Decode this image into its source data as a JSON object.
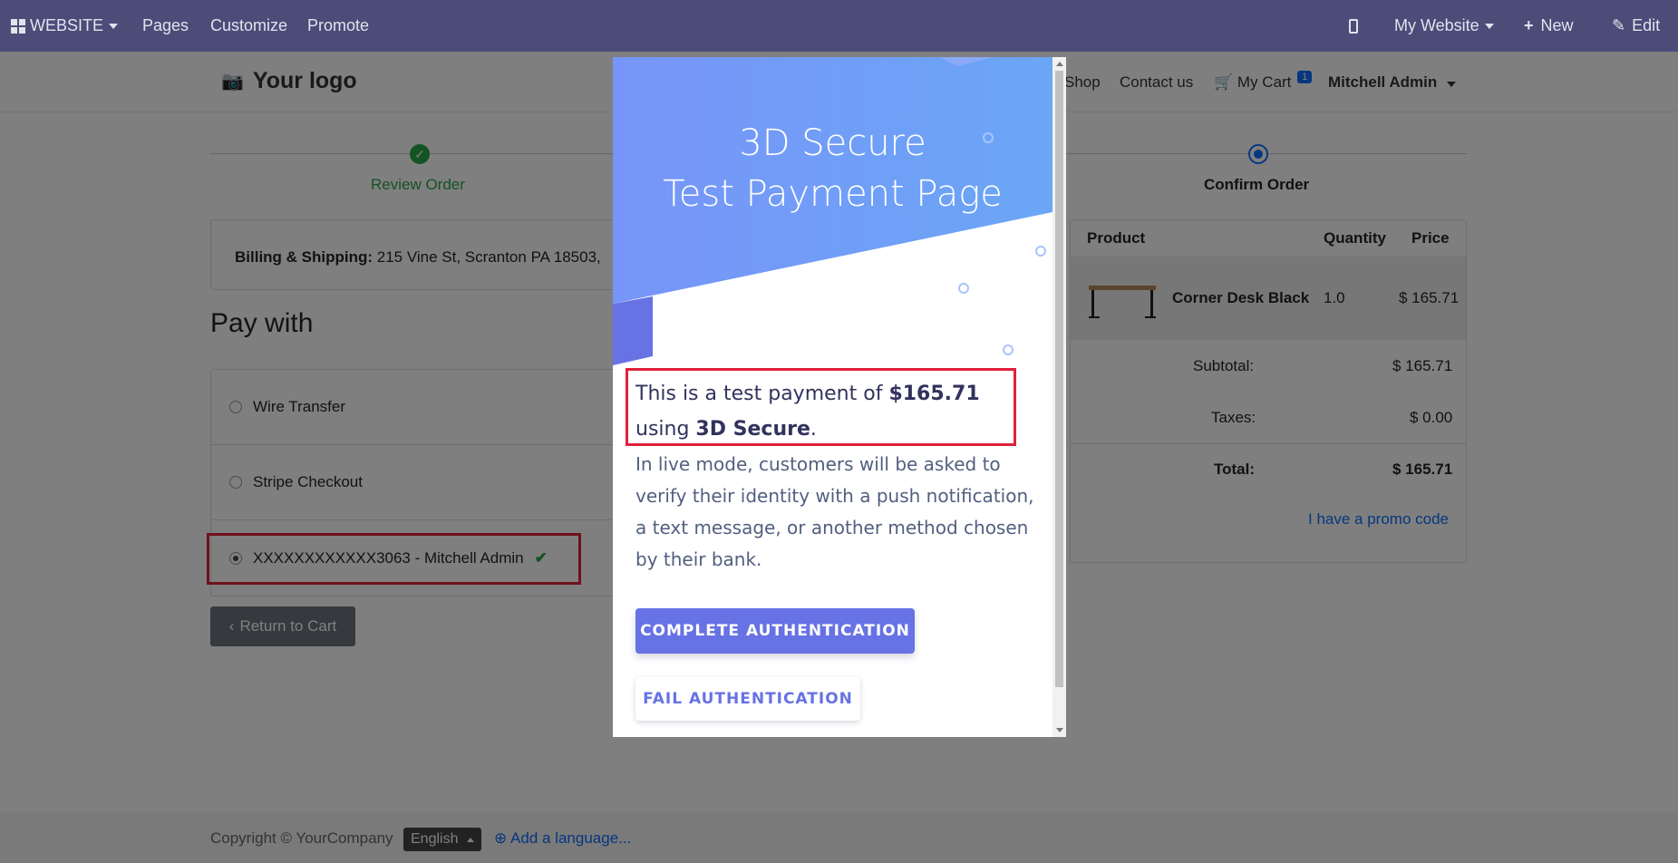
{
  "topbar": {
    "website_label": "WEBSITE",
    "pages": "Pages",
    "customize": "Customize",
    "promote": "Promote",
    "my_website": "My Website",
    "new": "New",
    "edit": "Edit"
  },
  "header": {
    "logo": "Your logo",
    "nav": {
      "shop": "Shop",
      "contact": "Contact us",
      "cart": "My Cart",
      "cart_count": "1",
      "user": "Mitchell Admin"
    }
  },
  "steps": {
    "review": "Review Order",
    "confirm": "Confirm Order"
  },
  "billing": {
    "label": "Billing & Shipping:",
    "address": "215 Vine St, Scranton PA 18503,"
  },
  "payment": {
    "title": "Pay with",
    "options": [
      {
        "label": "Wire Transfer"
      },
      {
        "label": "Stripe Checkout"
      },
      {
        "label": "XXXXXXXXXXXX3063 - Mitchell Admin"
      }
    ],
    "return_button": "Return to Cart"
  },
  "cart": {
    "headers": {
      "product": "Product",
      "quantity": "Quantity",
      "price": "Price"
    },
    "item": {
      "name": "Corner Desk Black",
      "quantity": "1.0",
      "price": "$ 165.71"
    },
    "subtotal_label": "Subtotal:",
    "subtotal": "$ 165.71",
    "taxes_label": "Taxes:",
    "taxes": "$ 0.00",
    "total_label": "Total:",
    "total": "$ 165.71",
    "promo": "I have a promo code"
  },
  "footer": {
    "copyright": "Copyright © YourCompany",
    "language": "English",
    "add_language": "Add a language..."
  },
  "modal": {
    "title_line1": "3D Secure",
    "title_line2": "Test Payment Page",
    "msg_prefix": "This is a test payment of ",
    "amount": "$165.71",
    "msg_mid": " using ",
    "method": "3D Secure",
    "msg_suffix": ".",
    "live_mode_text": "In live mode, customers will be asked to verify their identity with a push notification, a text message, or another method chosen by their bank.",
    "complete_button": "COMPLETE AUTHENTICATION",
    "fail_button": "FAIL AUTHENTICATION"
  },
  "colors": {
    "topbar": "#4b4c78",
    "stripe_accent": "#6772e5",
    "highlight": "#e0213a",
    "success": "#28a745"
  }
}
